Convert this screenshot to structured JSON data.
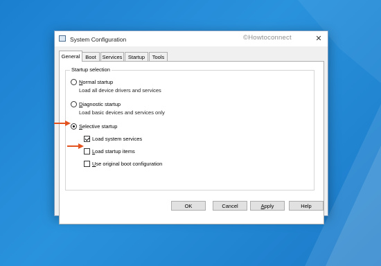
{
  "window": {
    "title": "System Configuration",
    "watermark": "©Howtoconnect",
    "close_glyph": "✕"
  },
  "tabs": [
    "General",
    "Boot",
    "Services",
    "Startup",
    "Tools"
  ],
  "active_tab": "General",
  "startup_selection": {
    "group_label": "Startup selection",
    "normal": {
      "label": "Normal startup",
      "accel": "N",
      "rest": "ormal startup",
      "desc": "Load all device drivers and services",
      "selected": false
    },
    "diagnostic": {
      "label": "Diagnostic startup",
      "accel": "D",
      "rest": "iagnostic startup",
      "desc": "Load basic devices and services only",
      "selected": false
    },
    "selective": {
      "label": "Selective startup",
      "accel": "S",
      "rest": "elective startup",
      "selected": true,
      "options": [
        {
          "label": "Load system services",
          "accel": "",
          "rest": "Load system services",
          "checked": true
        },
        {
          "label": "Load startup items",
          "accel": "L",
          "rest": "oad startup items",
          "checked": false
        },
        {
          "label": "Use original boot configuration",
          "accel": "U",
          "rest": "se original boot configuration",
          "checked": false
        }
      ]
    }
  },
  "buttons": {
    "ok": "OK",
    "cancel": "Cancel",
    "apply": {
      "accel": "A",
      "rest": "pply"
    },
    "help": "Help"
  },
  "colors": {
    "arrow": "#e2531f",
    "desktop": "#1b7fd0",
    "dialog_bg": "#f0f0f0"
  }
}
